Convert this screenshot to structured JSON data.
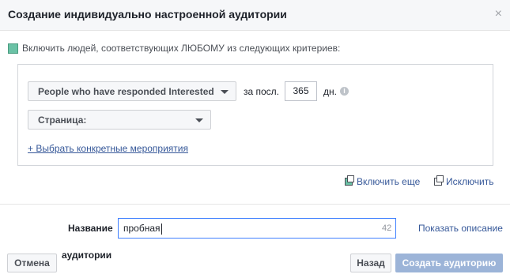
{
  "dialog": {
    "title": "Создание индивидуально настроенной аудитории",
    "close_glyph": "×"
  },
  "criteria": {
    "include_text": "Включить людей, соответствующих ЛЮБОМУ из следующих критериев:",
    "include_color": "#6bc2a6",
    "event_dropdown": "People who have responded Interested",
    "period_prefix": "за посл.",
    "days_value": "365",
    "days_suffix": "дн.",
    "info_glyph": "i",
    "page_dropdown": "Страница:",
    "choose_events_link": "+ Выбрать конкретные мероприятия"
  },
  "actions": {
    "include_more": "Включить еще",
    "exclude": "Исключить"
  },
  "name_section": {
    "label": "Название",
    "value": "пробная",
    "char_count": "42",
    "show_description": "Показать описание",
    "audience_label": "аудитории"
  },
  "footer": {
    "cancel": "Отмена",
    "back": "Назад",
    "create": "Создать аудиторию",
    "accent_color": "#4080ff"
  }
}
